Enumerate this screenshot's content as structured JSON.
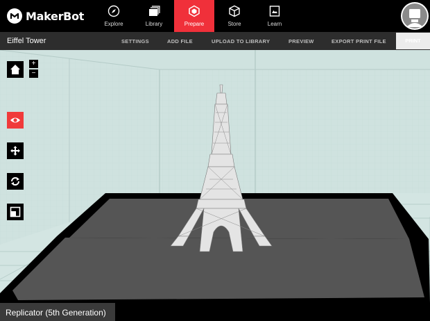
{
  "brand": {
    "name": "MakerBot"
  },
  "nav": {
    "tabs": [
      {
        "label": "Explore",
        "icon": "compass-icon"
      },
      {
        "label": "Library",
        "icon": "library-icon"
      },
      {
        "label": "Prepare",
        "icon": "prepare-icon",
        "active": true
      },
      {
        "label": "Store",
        "icon": "cube-icon"
      },
      {
        "label": "Learn",
        "icon": "learn-icon"
      }
    ],
    "accent": "#f0303a"
  },
  "toolbar": {
    "document_title": "Eiffel Tower",
    "buttons": [
      "SETTINGS",
      "ADD FILE",
      "UPLOAD TO LIBRARY",
      "PREVIEW",
      "EXPORT PRINT FILE"
    ],
    "print_label": "PRINT"
  },
  "viewport": {
    "tools": [
      "home-icon",
      "eye-icon",
      "move-icon",
      "rotate-icon",
      "scale-icon"
    ],
    "zoom_in": "+",
    "zoom_out": "−",
    "background": "#cfe2df",
    "plate_color": "#555555"
  },
  "status": {
    "printer": "Replicator (5th Generation)"
  }
}
